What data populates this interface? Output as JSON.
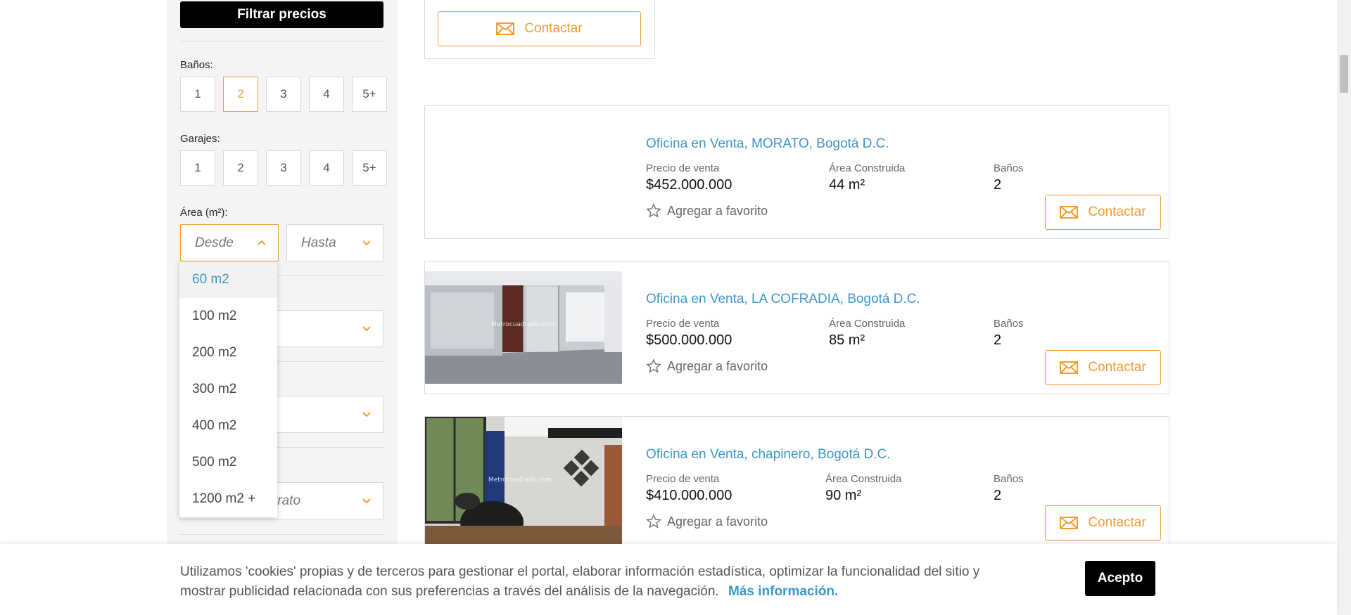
{
  "filters": {
    "filter_button": "Filtrar precios",
    "banos": {
      "label": "Baños:",
      "options": [
        "1",
        "2",
        "3",
        "4",
        "5+"
      ],
      "selected": "2"
    },
    "garajes": {
      "label": "Garajes:",
      "options": [
        "1",
        "2",
        "3",
        "4",
        "5+"
      ]
    },
    "area": {
      "label": "Área (m²):",
      "from_placeholder": "Desde",
      "to_placeholder": "Hasta",
      "dropdown_options": [
        "60 m2",
        "100 m2",
        "200 m2",
        "300 m2",
        "400 m2",
        "500 m2",
        "1200 m2 +"
      ],
      "highlighted_option": "60 m2"
    },
    "contract_select_partial": "trato"
  },
  "listings": {
    "contact_label": "Contactar",
    "price_label": "Precio de venta",
    "area_label": "Área Construida",
    "baths_label": "Baños",
    "favorite_label": "Agregar a favorito",
    "items": [
      {
        "title": "Oficina en Venta, MORATO, Bogotá D.C.",
        "price": "$452.000.000",
        "area": "44 m²",
        "baths": "2"
      },
      {
        "title": "Oficina en Venta, LA COFRADIA, Bogotá D.C.",
        "price": "$500.000.000",
        "area": "85 m²",
        "baths": "2",
        "watermark": "Metrocuadrado.com"
      },
      {
        "title": "Oficina en Venta, chapinero, Bogotá D.C.",
        "price": "$410.000.000",
        "area": "90 m²",
        "baths": "2",
        "watermark": "Metrocuadrado.com"
      }
    ]
  },
  "cookie": {
    "text": "Utilizamos 'cookies' propias y de terceros para gestionar el portal, elaborar información estadística, optimizar la funcionalidad del sitio y mostrar publicidad relacionada con sus preferencias a través del análisis de la navegación.",
    "link": "Más información.",
    "accept": "Acepto"
  },
  "colors": {
    "accent": "#f39c32",
    "link": "#3d97c9",
    "button_dark": "#000000"
  }
}
